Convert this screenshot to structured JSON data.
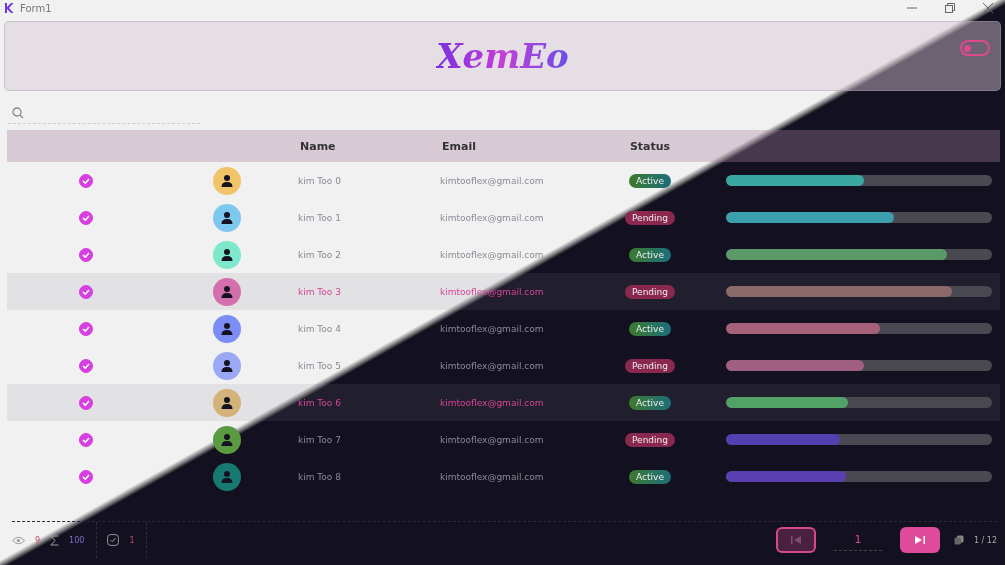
{
  "window": {
    "title": "Form1"
  },
  "header": {
    "logo": "XemEo",
    "theme_toggle": {
      "on": false
    }
  },
  "table": {
    "columns": [
      {
        "label": "Name"
      },
      {
        "label": "Email"
      },
      {
        "label": "Status"
      }
    ],
    "rows": [
      {
        "checked": true,
        "color": "#f2c46a",
        "name": "kim Too 0",
        "email": "kimtooflex@gmail.com",
        "status": {
          "label": "Active",
          "kind": "active"
        },
        "progress": {
          "level": 0.52,
          "color": "#3aa7a0"
        },
        "selected": false
      },
      {
        "checked": true,
        "color": "#7cc8ee",
        "name": "kim Too 1",
        "email": "kimtooflex@gmail.com",
        "status": {
          "label": "Pending",
          "kind": "pending"
        },
        "progress": {
          "level": 0.63,
          "color": "#3b9fae"
        },
        "selected": false
      },
      {
        "checked": true,
        "color": "#7de8cc",
        "name": "kim Too 2",
        "email": "kimtooflex@gmail.com",
        "status": {
          "label": "Active",
          "kind": "active"
        },
        "progress": {
          "level": 0.83,
          "color": "#5a9a6a"
        },
        "selected": false
      },
      {
        "checked": true,
        "color": "#d46fae",
        "name": "kim Too 3",
        "email": "kimtooflex@gmail.com",
        "status": {
          "label": "Pending",
          "kind": "pending"
        },
        "progress": {
          "level": 0.85,
          "color": "#8a6a6a"
        },
        "selected": true
      },
      {
        "checked": true,
        "color": "#7c8ef5",
        "name": "kim Too 4",
        "email": "kimtooflex@gmail.com",
        "status": {
          "label": "Active",
          "kind": "active"
        },
        "progress": {
          "level": 0.58,
          "color": "#a5607a"
        },
        "selected": false
      },
      {
        "checked": true,
        "color": "#9aa8f5",
        "name": "kim Too 5",
        "email": "kimtooflex@gmail.com",
        "status": {
          "label": "Pending",
          "kind": "pending"
        },
        "progress": {
          "level": 0.52,
          "color": "#a05f80"
        },
        "selected": false
      },
      {
        "checked": true,
        "color": "#d4b37a",
        "name": "kim Too 6",
        "email": "kimtooflex@gmail.com",
        "status": {
          "label": "Active",
          "kind": "active"
        },
        "progress": {
          "level": 0.46,
          "color": "#52a268"
        },
        "selected": true
      },
      {
        "checked": true,
        "color": "#5a9a40",
        "name": "kim Too 7",
        "email": "kimtooflex@gmail.com",
        "status": {
          "label": "Pending",
          "kind": "pending"
        },
        "progress": {
          "level": 0.43,
          "color": "#5040b0"
        },
        "selected": false
      },
      {
        "checked": true,
        "color": "#177a72",
        "name": "kim Too 8",
        "email": "kimtooflex@gmail.com",
        "status": {
          "label": "Active",
          "kind": "active"
        },
        "progress": {
          "level": 0.45,
          "color": "#5a40b0"
        },
        "selected": false
      }
    ]
  },
  "footer": {
    "views": "9",
    "total": "100",
    "checked_count": "1",
    "page": "1",
    "page_count": "1 / 12",
    "prev_disabled": true
  }
}
